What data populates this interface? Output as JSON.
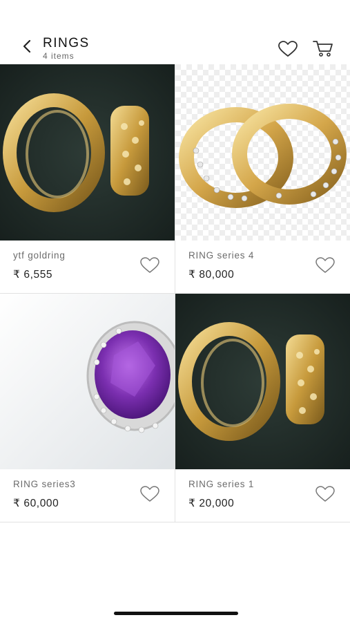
{
  "header": {
    "title": "RINGS",
    "count": "4 items"
  },
  "products": [
    {
      "name": "ytf goldring",
      "price": "₹ 6,555"
    },
    {
      "name": "RING series 4",
      "price": "₹ 80,000"
    },
    {
      "name": "RING series3",
      "price": "₹ 60,000"
    },
    {
      "name": "RING series 1",
      "price": "₹ 20,000"
    }
  ],
  "colors": {
    "gold": "#c9a24a",
    "dark_green": "#1e2a27",
    "purple_gem": "#7b2fb0"
  }
}
